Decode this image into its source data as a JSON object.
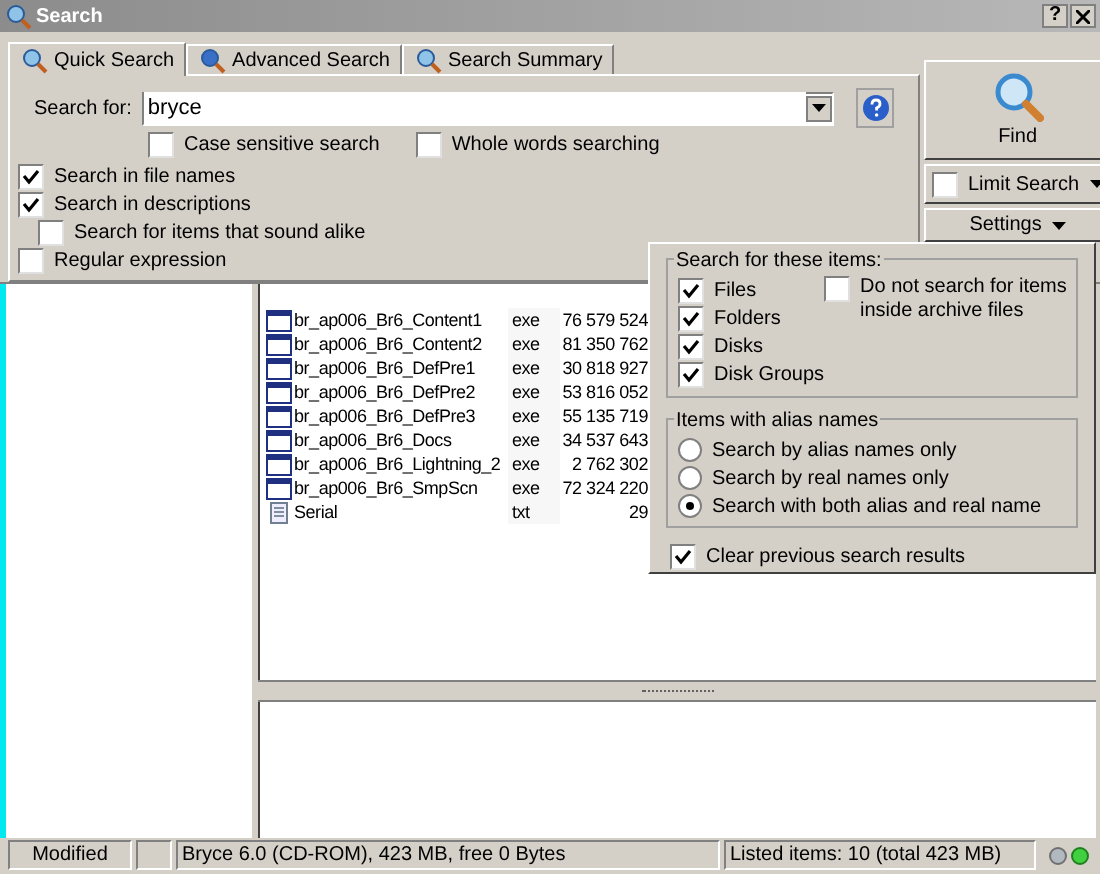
{
  "window": {
    "title": "Search",
    "help_button": "?"
  },
  "tabs": [
    {
      "label": "Quick Search",
      "selected": true
    },
    {
      "label": "Advanced Search",
      "selected": false
    },
    {
      "label": "Search Summary",
      "selected": false
    }
  ],
  "search": {
    "label": "Search for:",
    "value": "bryce"
  },
  "inline_options": [
    {
      "label": "Case sensitive search",
      "checked": false
    },
    {
      "label": "Whole words searching",
      "checked": false
    }
  ],
  "options": [
    {
      "label": "Search in file names",
      "checked": true
    },
    {
      "label": "Search in descriptions",
      "checked": true,
      "children": [
        {
          "label": "Search for items that sound alike",
          "checked": false
        }
      ]
    },
    {
      "label": "Regular expression",
      "checked": false
    }
  ],
  "buttons": {
    "find": "Find",
    "limit_search": {
      "label": "Limit Search",
      "checked": false
    },
    "settings": "Settings"
  },
  "settings_menu": {
    "items_group": {
      "title": "Search for these items:",
      "items": [
        {
          "label": "Files",
          "checked": true
        },
        {
          "label": "Folders",
          "checked": true
        },
        {
          "label": "Disks",
          "checked": true
        },
        {
          "label": "Disk Groups",
          "checked": true
        }
      ],
      "archive": {
        "label": "Do not search for items inside archive files",
        "checked": false
      }
    },
    "alias_group": {
      "title": "Items with alias names",
      "options": [
        {
          "label": "Search by alias names only",
          "selected": false
        },
        {
          "label": "Search by real names only",
          "selected": false
        },
        {
          "label": "Search with both alias and real name",
          "selected": true
        }
      ]
    },
    "clear_results": {
      "label": "Clear previous search results",
      "checked": true
    }
  },
  "files": [
    {
      "name": "br_ap006_Br6_Content1",
      "ext": "exe",
      "size": "76 579 524",
      "kind": "program"
    },
    {
      "name": "br_ap006_Br6_Content2",
      "ext": "exe",
      "size": "81 350 762",
      "kind": "program"
    },
    {
      "name": "br_ap006_Br6_DefPre1",
      "ext": "exe",
      "size": "30 818 927",
      "kind": "program"
    },
    {
      "name": "br_ap006_Br6_DefPre2",
      "ext": "exe",
      "size": "53 816 052",
      "kind": "program"
    },
    {
      "name": "br_ap006_Br6_DefPre3",
      "ext": "exe",
      "size": "55 135 719",
      "kind": "program"
    },
    {
      "name": "br_ap006_Br6_Docs",
      "ext": "exe",
      "size": "34 537 643",
      "kind": "program"
    },
    {
      "name": "br_ap006_Br6_Lightning_2",
      "ext": "exe",
      "size": "2 762 302",
      "kind": "program"
    },
    {
      "name": "br_ap006_Br6_SmpScn",
      "ext": "exe",
      "size": "72 324 220",
      "kind": "program"
    },
    {
      "name": "Serial",
      "ext": "txt",
      "size": "29",
      "kind": "text"
    }
  ],
  "status_bar": {
    "state": "Modified",
    "drive": "Bryce 6.0 (CD-ROM), 423 MB, free 0 Bytes",
    "listed": "Listed items: 10 (total 423 MB)"
  }
}
